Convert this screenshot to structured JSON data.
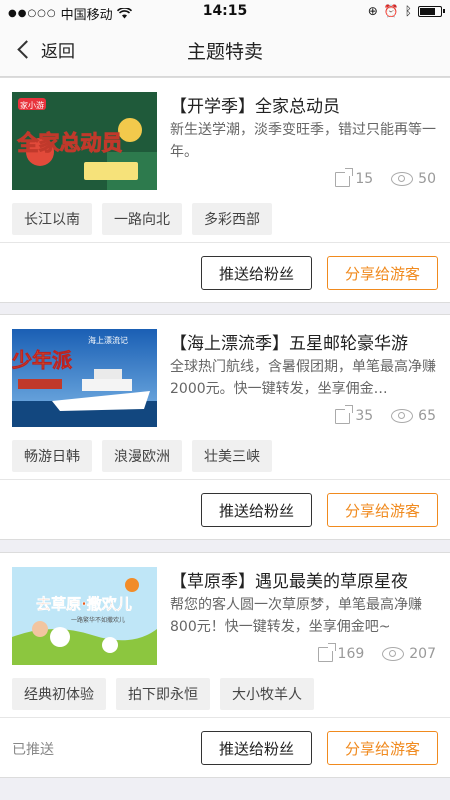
{
  "status_bar": {
    "carrier": "中国移动",
    "signal_dots": "●●○○○",
    "time": "14:15"
  },
  "nav": {
    "back_label": "返回",
    "title": "主题特卖"
  },
  "cards": [
    {
      "title": "【开学季】全家总动员",
      "description": "新生送学潮，淡季变旺季，错过只能再等一年。",
      "shares": "15",
      "views": "50",
      "tags": [
        "长江以南",
        "一路向北",
        "多彩西部"
      ],
      "status": "",
      "push_label": "推送给粉丝",
      "share_label": "分享给游客",
      "thumb_text": "全家总动员",
      "thumb_badge": "家小游"
    },
    {
      "title": "【海上漂流季】五星邮轮豪华游",
      "description": "全球热门航线，含暑假团期，单笔最高净赚2000元。快一键转发，坐享佣金…",
      "shares": "35",
      "views": "65",
      "tags": [
        "畅游日韩",
        "浪漫欧洲",
        "壮美三峡"
      ],
      "status": "",
      "push_label": "推送给粉丝",
      "share_label": "分享给游客",
      "thumb_text": "少年派",
      "thumb_badge": "海上漂流记"
    },
    {
      "title": "【草原季】遇见最美的草原星夜",
      "description": "帮您的客人圆一次草原梦，单笔最高净赚800元！快一键转发，坐享佣金吧~",
      "shares": "169",
      "views": "207",
      "tags": [
        "经典初体验",
        "拍下即永恒",
        "大小牧羊人"
      ],
      "status": "已推送",
      "push_label": "推送给粉丝",
      "share_label": "分享给游客",
      "thumb_text": "去草原·撒欢儿",
      "thumb_badge": "一路繁华不如撒欢儿"
    }
  ]
}
